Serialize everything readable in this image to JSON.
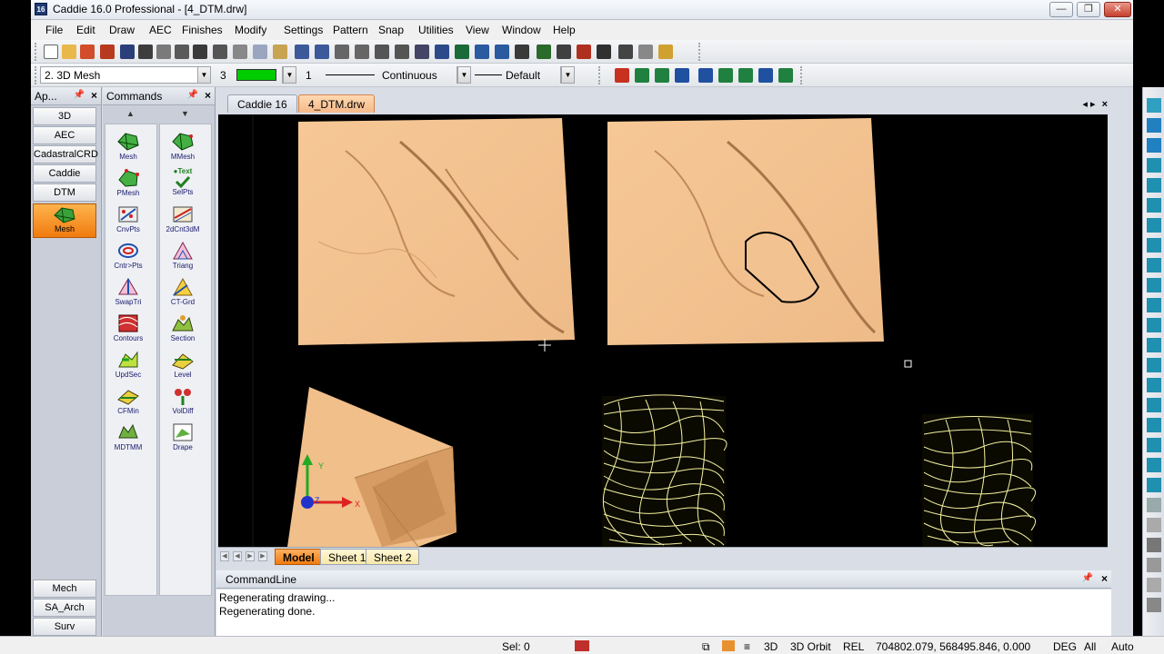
{
  "window": {
    "title": "Caddie 16.0 Professional - [4_DTM.drw]",
    "app_icon_label": "16",
    "controls": {
      "minimize": "—",
      "maximize": "❐",
      "close": "✕"
    }
  },
  "menu": [
    "File",
    "Edit",
    "Draw",
    "AEC",
    "Finishes",
    "Modify",
    "Settings",
    "Pattern",
    "Snap",
    "Utilities",
    "View",
    "Window",
    "Help"
  ],
  "layer_bar": {
    "layer": "2. 3D Mesh",
    "color_num": "3",
    "line_weight": "1",
    "line_type": "Continuous",
    "pen": "Default",
    "layer_color": "#00cc00"
  },
  "apps_panel": {
    "title": "Ap...",
    "items_top": [
      "3D",
      "AEC",
      "CadastralCRD",
      "Caddie",
      "DTM"
    ],
    "active": "Mesh",
    "items_bottom": [
      "Mech",
      "SA_Arch",
      "Surv"
    ]
  },
  "commands_panel": {
    "title": "Commands",
    "col1": [
      "Mesh",
      "PMesh",
      "CnvPts",
      "Cntr>Pts",
      "SwapTri",
      "Contours",
      "UpdSec",
      "CFMin",
      "MDTMM"
    ],
    "col2": [
      "MMesh",
      "SelPts",
      "2dCnt3dM",
      "Triang",
      "CT-Grd",
      "Section",
      "Level",
      "VolDiff",
      "Drape"
    ],
    "col2_extra": "Text"
  },
  "doc_tabs": [
    {
      "label": "Caddie 16",
      "active": false
    },
    {
      "label": "4_DTM.drw",
      "active": true
    }
  ],
  "sheet_tabs": [
    {
      "label": "Model",
      "active": true
    },
    {
      "label": "Sheet 1",
      "active": false
    },
    {
      "label": "Sheet 2",
      "active": false
    }
  ],
  "commandline": {
    "title": "CommandLine",
    "lines": [
      "Regenerating drawing...",
      "Regenerating done."
    ]
  },
  "status": {
    "sel": "Sel: 0",
    "mode_3d": "3D",
    "orbit": "3D Orbit",
    "rel": "REL",
    "coords": "704802.079, 568495.846, 0.000",
    "deg": "DEG",
    "all": "All",
    "auto": "Auto"
  },
  "ucs": {
    "x": "X",
    "y": "Y",
    "z": "Z"
  },
  "colors": {
    "terrain": "#f2c391",
    "terrain_shade": "#d59a63",
    "contour": "#f5f2a0",
    "active_tab": "#f5b98a"
  }
}
